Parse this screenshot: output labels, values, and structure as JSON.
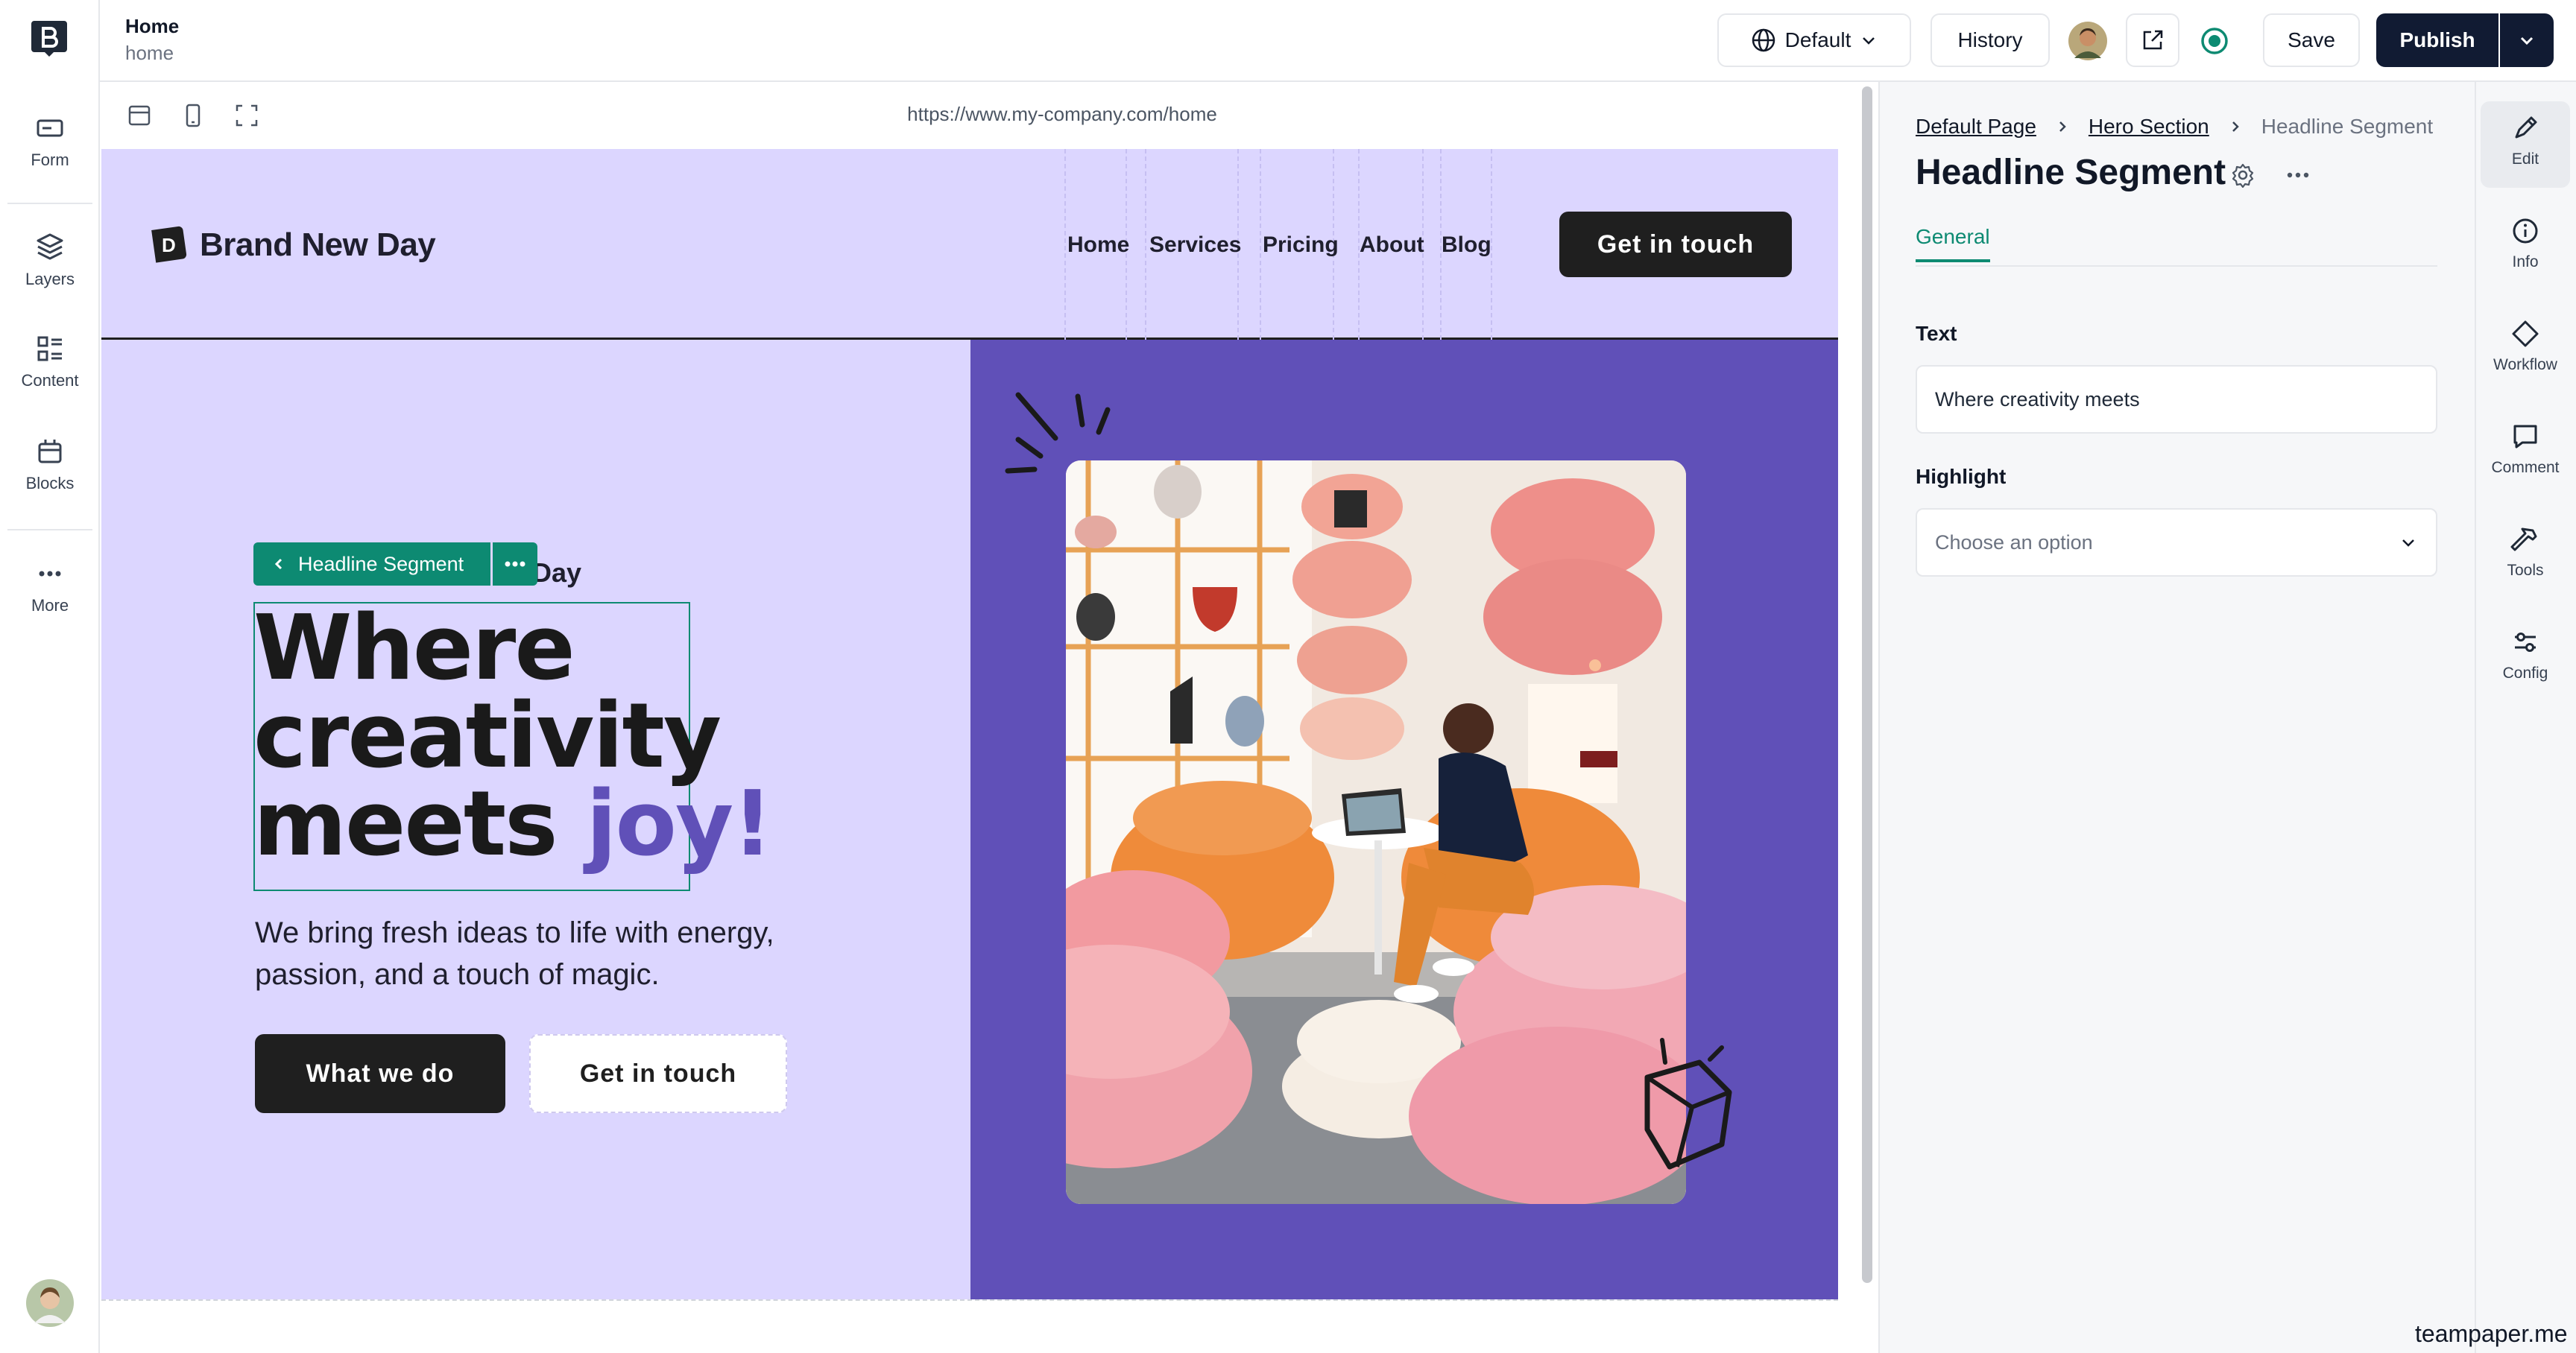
{
  "left_rail": {
    "items": [
      {
        "label": "Form",
        "icon": "form-icon"
      },
      {
        "label": "Layers",
        "icon": "layers-icon"
      },
      {
        "label": "Content",
        "icon": "content-icon"
      },
      {
        "label": "Blocks",
        "icon": "blocks-icon"
      },
      {
        "label": "More",
        "icon": "more-icon"
      }
    ]
  },
  "topbar": {
    "page_title": "Home",
    "page_slug": "home",
    "locale_label": "Default",
    "history_label": "History",
    "save_label": "Save",
    "publish_label": "Publish"
  },
  "canvas": {
    "url": "https://www.my-company.com/home"
  },
  "site": {
    "brand_name": "Brand New Day",
    "brand_initial": "D",
    "nav": [
      "Home",
      "Services",
      "Pricing",
      "About",
      "Blog"
    ],
    "header_cta": "Get in touch",
    "eyebrow_visible": "w Day",
    "selection_tag": "Headline Segment",
    "headline_line1": "Where",
    "headline_line2": "creativity",
    "headline_line3": "meets",
    "headline_highlight": "joy!",
    "subcopy": "We bring fresh ideas to life with energy, passion, and a touch of magic.",
    "primary_button": "What we do",
    "secondary_button": "Get in touch"
  },
  "panel": {
    "breadcrumbs": [
      "Default Page",
      "Hero Section",
      "Headline Segment"
    ],
    "title": "Headline Segment",
    "tab": "General",
    "text_label": "Text",
    "text_value": "Where creativity meets",
    "highlight_label": "Highlight",
    "highlight_placeholder": "Choose an option"
  },
  "right_rail": {
    "items": [
      {
        "label": "Edit",
        "icon": "pencil-icon"
      },
      {
        "label": "Info",
        "icon": "info-icon"
      },
      {
        "label": "Workflow",
        "icon": "diamond-icon"
      },
      {
        "label": "Comment",
        "icon": "comment-icon"
      },
      {
        "label": "Tools",
        "icon": "hammer-icon"
      },
      {
        "label": "Config",
        "icon": "sliders-icon"
      }
    ]
  },
  "watermark": "teampaper.me",
  "colors": {
    "accent_green": "#0d8a72",
    "hero_lavender": "#dcd6ff",
    "hero_purple": "#6050b8",
    "publish_navy": "#111b33"
  }
}
